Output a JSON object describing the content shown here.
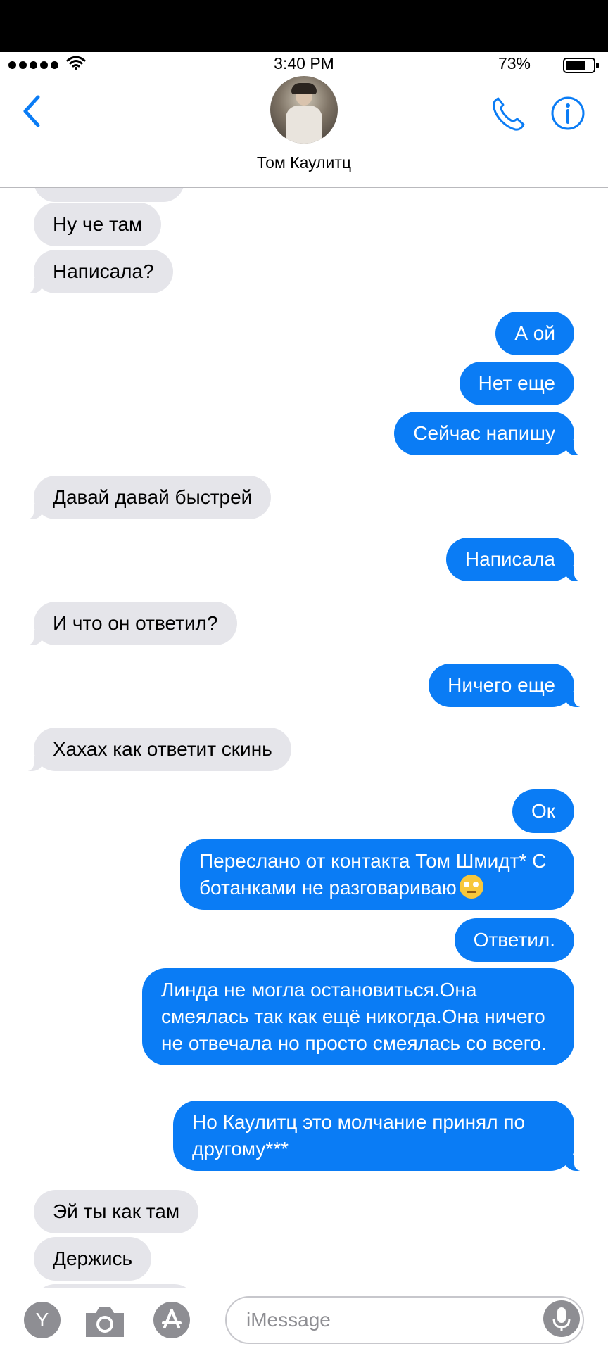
{
  "status_bar": {
    "time": "3:40 PM",
    "battery": "73%"
  },
  "header": {
    "contact_name": "Том Каулитц"
  },
  "messages": [
    {
      "side": "in",
      "text": "Ну че там"
    },
    {
      "side": "in",
      "text": "Написала?"
    },
    {
      "side": "out",
      "text": "А ой"
    },
    {
      "side": "out",
      "text": "Нет еще"
    },
    {
      "side": "out",
      "text": "Сейчас напишу"
    },
    {
      "side": "in",
      "text": "Давай давай быстрей"
    },
    {
      "side": "out",
      "text": "Написала"
    },
    {
      "side": "in",
      "text": "И что он ответил?"
    },
    {
      "side": "out",
      "text": "Ничего еще"
    },
    {
      "side": "in",
      "text": "Хахах как ответит скинь"
    },
    {
      "side": "out",
      "text": "Ок"
    },
    {
      "side": "out",
      "text": "Переслано от контакта Том Шмидт* С ботанками не разговариваю"
    },
    {
      "side": "out",
      "text": "Ответил."
    },
    {
      "side": "out",
      "text": "Линда не могла остановиться.Она смеялась так как ещё никогда.Она ничего не отвечала но просто смеялась со всего."
    },
    {
      "side": "out",
      "text": "Но Каулитц это молчание принял по другому***"
    },
    {
      "side": "in",
      "text": "Эй ты как там"
    },
    {
      "side": "in",
      "text": "Держись"
    }
  ],
  "composer": {
    "placeholder": "iMessage",
    "app_button_letter": "Y"
  },
  "colors": {
    "accent": "#0a7cf5",
    "incoming": "#e5e5ea"
  },
  "icons": [
    "back-chevron-icon",
    "phone-icon",
    "info-icon",
    "camera-icon",
    "app-store-icon",
    "microphone-icon",
    "emoji-eye-roll-icon"
  ]
}
